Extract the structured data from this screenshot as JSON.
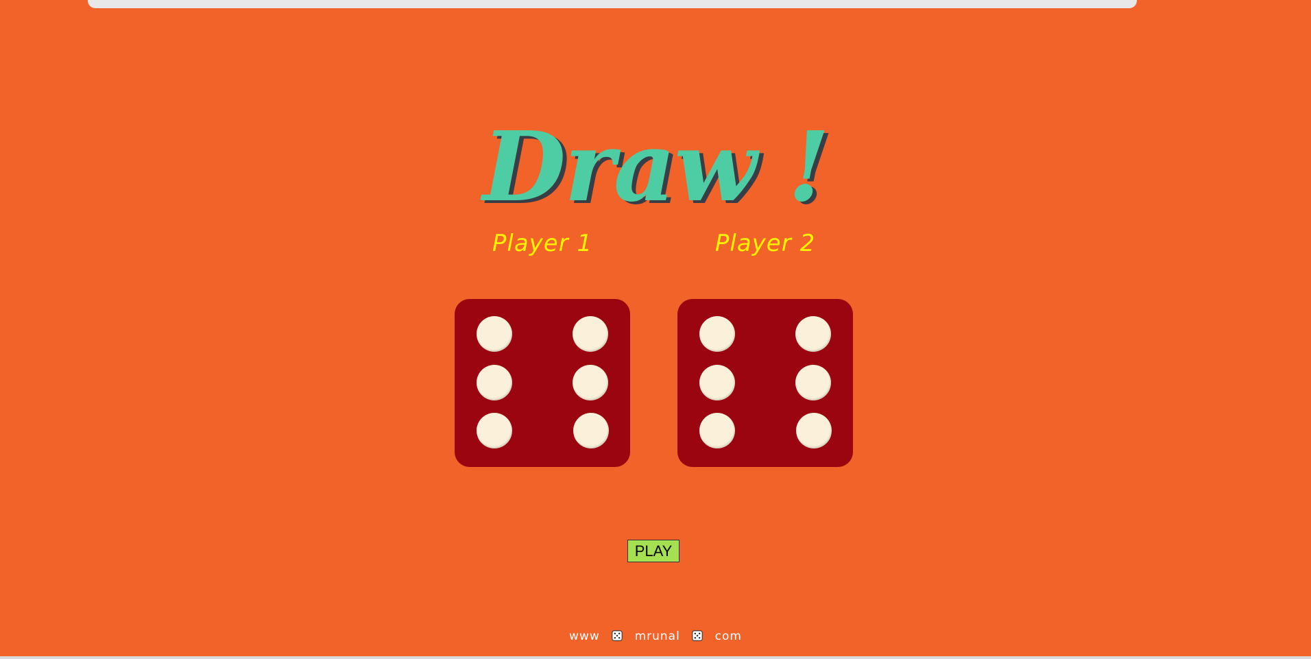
{
  "game": {
    "title": "Draw !",
    "players": [
      {
        "label": "Player 1",
        "die_value": 6
      },
      {
        "label": "Player 2",
        "die_value": 6
      }
    ],
    "play_button_label": "PLAY"
  },
  "footer": {
    "part1": "www",
    "part2": "mrunal",
    "part3": "com",
    "separator_icon": "die-icon"
  },
  "colors": {
    "background": "#f16329",
    "title": "#4ecca3",
    "title_shadow": "#393e46",
    "player_label": "#fff200",
    "die_face": "#9a0510",
    "pip": "#fbf0da",
    "play_button": "#a4e051"
  }
}
